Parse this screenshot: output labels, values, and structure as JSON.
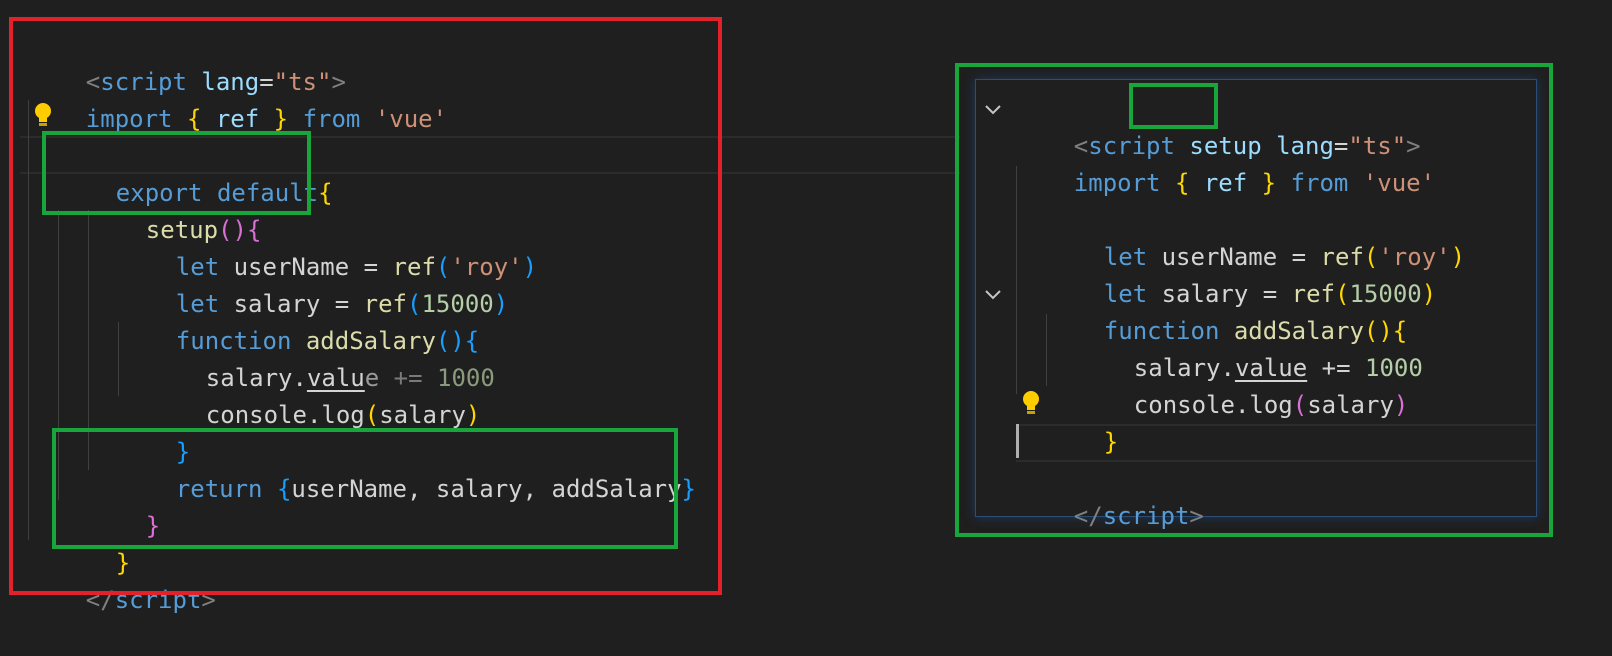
{
  "colors": {
    "tag": "#808080",
    "keyword": "#569cd6",
    "attr": "#9cdcfe",
    "string": "#ce9178",
    "number": "#b5cea8",
    "text": "#d4d4d4",
    "fn": "#dcdcaa",
    "brace_gold": "#ffd700",
    "brace_pink": "#da70d6",
    "brace_blue": "#179fff",
    "red_box": "#e3212b",
    "green_box": "#18a53c"
  },
  "left_code": {
    "l1": {
      "open": "<",
      "tag": "script",
      "sp": " ",
      "attr": "lang",
      "eq": "=",
      "val": "\"ts\"",
      "close": ">"
    },
    "l2": {
      "kw": "import",
      "s1": " ",
      "b1": "{",
      "mid": " ref ",
      "b2": "}",
      "s2": " ",
      "kw2": "from",
      "s3": " ",
      "str": "'vue'"
    },
    "l4": {
      "kw": "export",
      "s1": " ",
      "kw2": "default",
      "brace": "{"
    },
    "l5": {
      "fn": "setup",
      "paren": "()",
      "brace": "{"
    },
    "l6": {
      "kw": "let",
      "rest": " userName = ",
      "fn": "ref",
      "p1": "(",
      "str": "'roy'",
      "p2": ")"
    },
    "l7": {
      "kw": "let",
      "rest": " salary = ",
      "fn": "ref",
      "p1": "(",
      "num": "15000",
      "p2": ")"
    },
    "l8": {
      "kw": "function",
      "s": " ",
      "fn": "addSalary",
      "paren": "()",
      "brace": "{"
    },
    "l9": {
      "obj": "salary.",
      "prop": "valu",
      "prop2": "e",
      "op": " += ",
      "num": "1000"
    },
    "l10": {
      "obj": "console.",
      "fn": "log",
      "p1": "(",
      "arg": "salary",
      "p2": ")"
    },
    "l11": {
      "brace": "}"
    },
    "l12": {
      "kw": "return",
      "s": " ",
      "b1": "{",
      "body": "userName, salary, addSalary",
      "b2": "}"
    },
    "l13": {
      "brace": "}"
    },
    "l14": {
      "brace": "}"
    },
    "l15": {
      "open": "</",
      "tag": "script",
      "close": ">"
    }
  },
  "right_code": {
    "l1": {
      "open": "<",
      "tag": "script",
      "sp": " ",
      "attr_setup": "setup",
      "sp2": " ",
      "attr": "lang",
      "eq": "=",
      "val": "\"ts\"",
      "close": ">"
    },
    "l2": {
      "kw": "import",
      "s1": " ",
      "b1": "{",
      "mid": " ref ",
      "b2": "}",
      "s2": " ",
      "kw2": "from",
      "s3": " ",
      "str": "'vue'"
    },
    "l4": {
      "kw": "let",
      "rest": " userName = ",
      "fn": "ref",
      "p1": "(",
      "str": "'roy'",
      "p2": ")"
    },
    "l5": {
      "kw": "let",
      "rest": " salary = ",
      "fn": "ref",
      "p1": "(",
      "num": "15000",
      "p2": ")"
    },
    "l6": {
      "kw": "function",
      "s": " ",
      "fn": "addSalary",
      "paren": "()",
      "brace": "{"
    },
    "l7": {
      "obj": "salary.",
      "prop": "value",
      "op": " += ",
      "num": "1000"
    },
    "l8": {
      "obj": "console.",
      "fn": "log",
      "p1": "(",
      "arg": "salary",
      "p2": ")"
    },
    "l9": {
      "brace": "}"
    },
    "l11": {
      "open": "</",
      "tag": "script",
      "close": ">"
    }
  },
  "icons": {
    "lightbulb": "lightbulb-icon",
    "fold": "chevron-down-icon"
  }
}
